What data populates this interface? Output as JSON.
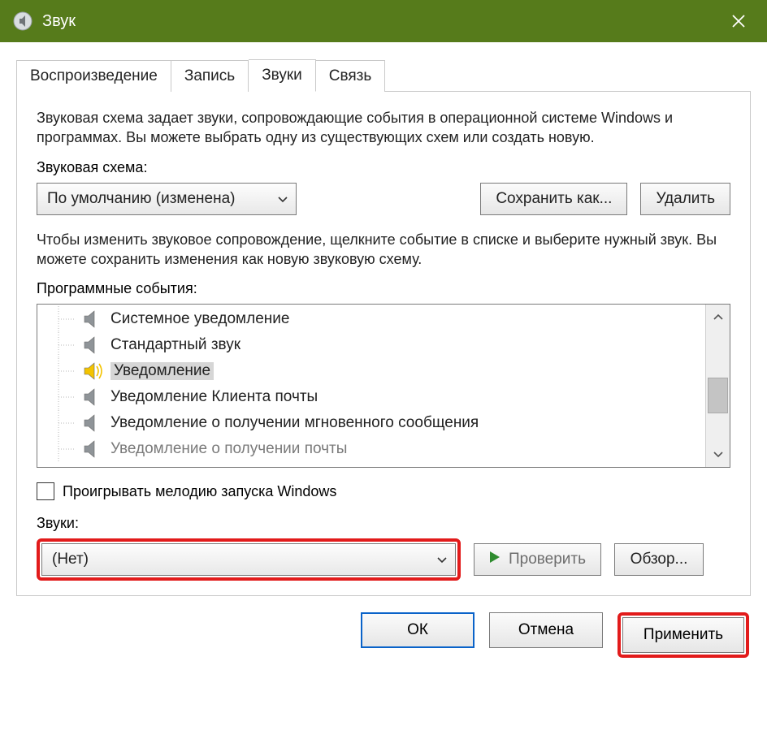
{
  "titlebar": {
    "title": "Звук"
  },
  "tabs": {
    "playback": "Воспроизведение",
    "recording": "Запись",
    "sounds": "Звуки",
    "communications": "Связь",
    "active": "sounds"
  },
  "description1": "Звуковая схема задает звуки, сопровождающие события в операционной системе Windows и программах. Вы можете выбрать одну из существующих схем или создать новую.",
  "scheme": {
    "label": "Звуковая схема:",
    "value": "По умолчанию (изменена)",
    "save_as": "Сохранить как...",
    "delete": "Удалить"
  },
  "description2": "Чтобы изменить звуковое сопровождение, щелкните событие в списке и выберите нужный звук. Вы можете сохранить изменения как новую звуковую схему.",
  "events": {
    "label": "Программные события:",
    "items": [
      {
        "label": "Системное уведомление",
        "selected": false,
        "playing": false
      },
      {
        "label": "Стандартный звук",
        "selected": false,
        "playing": false
      },
      {
        "label": "Уведомление",
        "selected": true,
        "playing": true
      },
      {
        "label": "Уведомление Клиента почты",
        "selected": false,
        "playing": false
      },
      {
        "label": "Уведомление о получении мгновенного сообщения",
        "selected": false,
        "playing": false
      },
      {
        "label": "Уведомление о получении почты",
        "selected": false,
        "playing": false
      }
    ]
  },
  "startup": {
    "label": "Проигрывать мелодию запуска Windows",
    "checked": false
  },
  "sound": {
    "label": "Звуки:",
    "value": "(Нет)",
    "test": "Проверить",
    "browse": "Обзор..."
  },
  "dialog": {
    "ok": "ОК",
    "cancel": "Отмена",
    "apply": "Применить"
  }
}
